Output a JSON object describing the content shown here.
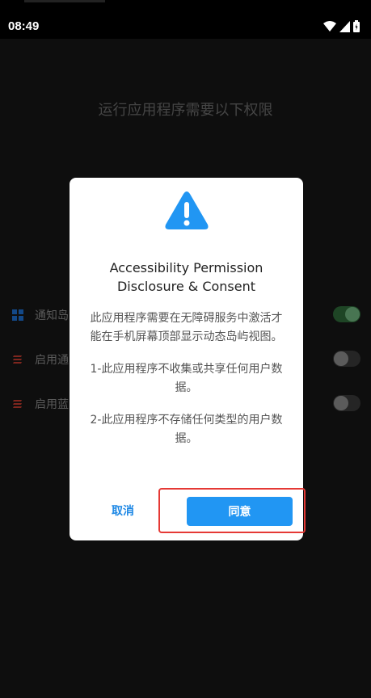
{
  "status_bar": {
    "time": "08:49"
  },
  "screen": {
    "title": "运行应用程序需要以下权限",
    "permissions": [
      {
        "label": "通知岛",
        "icon": "grid-icon",
        "enabled": true
      },
      {
        "label": "启用通",
        "icon": "stripes-icon",
        "enabled": false
      },
      {
        "label": "启用蓝",
        "icon": "stripes-icon",
        "enabled": false
      }
    ]
  },
  "dialog": {
    "title_line1": "Accessibility Permission",
    "title_line2": "Disclosure & Consent",
    "body": [
      "此应用程序需要在无障碍服务中激活才能在手机屏幕顶部显示动态岛屿视图。",
      "1-此应用程序不收集或共享任何用户数据。",
      "2-此应用程序不存储任何类型的用户数据。"
    ],
    "cancel_label": "取消",
    "agree_label": "同意"
  },
  "colors": {
    "accent": "#2196f3",
    "highlight": "#e53935",
    "toggle_on": "#6fb47f"
  }
}
